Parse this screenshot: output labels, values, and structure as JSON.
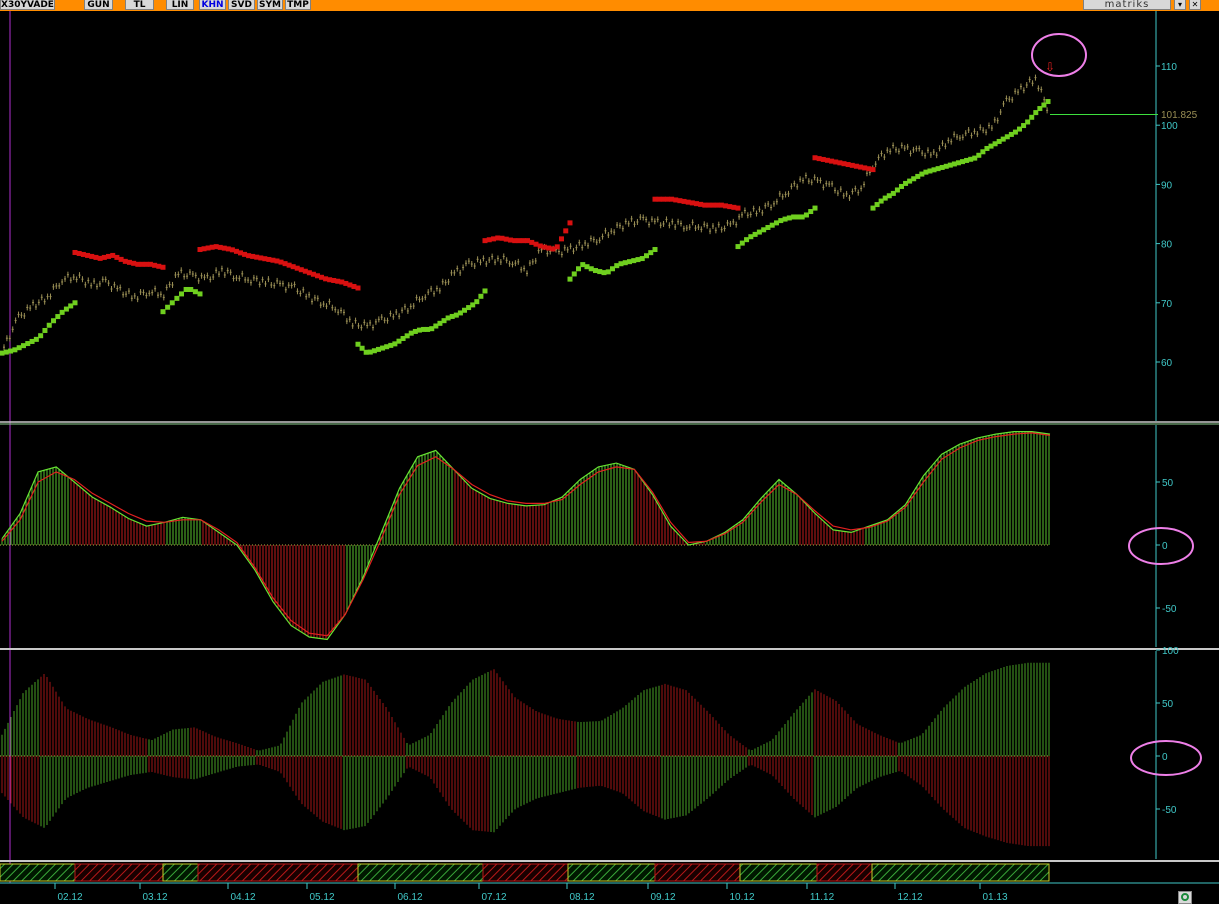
{
  "toolbar": {
    "symbol": "X30YVADE",
    "buttons": [
      {
        "label": "GUN",
        "active": false
      },
      {
        "label": "TL",
        "active": false
      },
      {
        "label": "LIN",
        "active": false
      },
      {
        "label": "KHN",
        "active": true
      },
      {
        "label": "SVD",
        "active": false
      },
      {
        "label": "SYM",
        "active": false
      },
      {
        "label": "TMP",
        "active": false
      }
    ],
    "brand": "matriks",
    "controls": [
      "scroll-down-icon",
      "close-icon"
    ]
  },
  "colors": {
    "toolbar_bg": "#ff8c00",
    "price": "#9a8f55",
    "trail_up": "#6fcf1f",
    "trail_down": "#d81010",
    "osc_up": "#66e233",
    "osc_down": "#e22020",
    "axis": "#40c8c8",
    "highlight_circle": "#ee7fe8"
  },
  "chart_data": [
    {
      "type": "line",
      "title": "",
      "last_price_label": "101.825",
      "ylim": [
        50,
        115
      ],
      "yticks": [
        50,
        60,
        70,
        80,
        90,
        100,
        110
      ],
      "xticks": [
        "02.12",
        "03.12",
        "04.12",
        "05.12",
        "06.12",
        "07.12",
        "08.12",
        "09.12",
        "10.12",
        "11.12",
        "12.12",
        "01.13"
      ],
      "series": [
        {
          "values": [
            62.5,
            67.5,
            69.5,
            71.0,
            74.0,
            74.5,
            73.0,
            73.5,
            72.0,
            71.0,
            72.0,
            71.5,
            75.0,
            74.5,
            74.0,
            75.5,
            74.5,
            74.0,
            73.5,
            73.0,
            72.5,
            71.0,
            70.0,
            69.0,
            66.5,
            66.0,
            67.0,
            68.0,
            69.5,
            71.5,
            72.5,
            75.0,
            76.5,
            77.0,
            77.5,
            77.0,
            75.5,
            79.0,
            78.5,
            79.0,
            80.0,
            81.0,
            82.5,
            83.5,
            84.0,
            83.5,
            83.5,
            83.0,
            83.0,
            82.5,
            83.0,
            85.0,
            85.5,
            87.0,
            89.0,
            91.0,
            90.5,
            89.5,
            88.0,
            89.5,
            94.0,
            96.0,
            96.0,
            95.5,
            95.0,
            97.5,
            98.5,
            99.0,
            99.5,
            104.0,
            106.0,
            108.0,
            101.8
          ]
        }
      ],
      "trail_up_segments": [
        [
          61.5,
          62.0,
          63.0,
          64.0,
          66.5,
          68.5,
          70.0
        ],
        [
          68.5,
          70.5,
          72.5,
          71.5
        ],
        [
          63.0,
          61.5,
          62.0,
          62.5,
          63.0,
          64.0,
          65.0,
          65.5,
          65.5,
          66.5,
          67.5,
          68.0,
          69.0,
          70.0,
          72.0
        ],
        [
          74.0,
          76.5,
          75.5,
          75.0,
          76.5,
          77.0,
          77.5,
          79.0
        ],
        [
          79.5,
          81.0,
          82.0,
          83.0,
          84.0,
          84.5,
          84.5,
          86.0
        ],
        [
          86.0,
          87.5,
          88.5,
          90.0,
          91.0,
          92.0,
          92.5,
          93.0,
          93.5,
          94.0,
          94.5,
          96.0,
          97.0,
          98.0,
          99.0,
          100.5,
          102.5,
          104.0
        ]
      ],
      "trail_down_segments": [
        [
          78.5,
          78.0,
          77.5,
          78.0,
          77.0,
          76.5,
          76.5,
          76.0
        ],
        [
          79.0,
          79.5,
          79.0,
          78.0,
          77.5,
          77.0,
          76.0,
          75.0,
          74.0,
          73.5,
          72.5
        ],
        [
          80.5,
          81.0,
          80.5,
          80.5,
          79.5,
          79.0,
          83.5
        ],
        [
          87.5,
          87.5,
          87.0,
          86.5,
          86.5,
          86.0
        ],
        [
          94.5,
          94.0,
          93.5,
          93.0,
          92.5
        ]
      ],
      "annotations": [
        "sell-arrow-icon",
        "highlight-circle"
      ]
    },
    {
      "type": "line",
      "title": "",
      "ylim": [
        -80,
        95
      ],
      "yticks": [
        -50,
        0,
        50
      ],
      "series": [
        {
          "values": [
            5,
            25,
            58,
            62,
            50,
            38,
            30,
            21,
            15,
            18,
            22,
            20,
            10,
            0,
            -20,
            -45,
            -64,
            -73,
            -75,
            -55,
            -25,
            10,
            45,
            70,
            75,
            60,
            45,
            37,
            33,
            31,
            32,
            38,
            52,
            62,
            65,
            60,
            40,
            15,
            0,
            3,
            10,
            20,
            37,
            52,
            40,
            25,
            12,
            10,
            15,
            20,
            32,
            55,
            72,
            80,
            85,
            88,
            90,
            90,
            88
          ]
        },
        {
          "values": [
            3,
            20,
            50,
            58,
            52,
            41,
            33,
            25,
            19,
            18,
            20,
            20,
            12,
            2,
            -18,
            -42,
            -60,
            -70,
            -72,
            -55,
            -27,
            5,
            40,
            63,
            70,
            60,
            48,
            40,
            35,
            33,
            33,
            36,
            48,
            58,
            62,
            60,
            42,
            18,
            2,
            3,
            9,
            18,
            34,
            48,
            40,
            27,
            15,
            12,
            14,
            19,
            30,
            50,
            68,
            77,
            83,
            86,
            88,
            89,
            87
          ]
        }
      ],
      "annotations": [
        "highlight-circle"
      ]
    },
    {
      "type": "bar",
      "title": "",
      "ylim": [
        -90,
        100
      ],
      "yticks": [
        -50,
        0,
        50,
        100
      ],
      "upper_values": [
        20,
        60,
        78,
        45,
        35,
        28,
        20,
        15,
        25,
        27,
        18,
        12,
        5,
        10,
        50,
        70,
        77,
        72,
        45,
        10,
        20,
        50,
        72,
        82,
        55,
        42,
        35,
        32,
        33,
        45,
        62,
        68,
        62,
        42,
        20,
        5,
        15,
        40,
        63,
        52,
        30,
        20,
        12,
        20,
        45,
        65,
        78,
        85,
        88,
        88
      ],
      "lower_values": [
        -35,
        -58,
        -68,
        -40,
        -30,
        -24,
        -18,
        -15,
        -20,
        -22,
        -16,
        -10,
        -8,
        -15,
        -45,
        -62,
        -70,
        -66,
        -40,
        -10,
        -20,
        -50,
        -70,
        -72,
        -50,
        -40,
        -35,
        -30,
        -28,
        -35,
        -52,
        -60,
        -56,
        -40,
        -22,
        -8,
        -18,
        -40,
        -58,
        -48,
        -30,
        -20,
        -14,
        -28,
        -50,
        -68,
        -76,
        -82,
        -85,
        -85
      ]
    }
  ],
  "signal_bar": {
    "segments": [
      {
        "state": "up",
        "span": 75
      },
      {
        "state": "down",
        "span": 88
      },
      {
        "state": "up",
        "span": 35
      },
      {
        "state": "down",
        "span": 160
      },
      {
        "state": "up",
        "span": 125
      },
      {
        "state": "down",
        "span": 85
      },
      {
        "state": "up",
        "span": 87
      },
      {
        "state": "down",
        "span": 85
      },
      {
        "state": "up",
        "span": 77
      },
      {
        "state": "down",
        "span": 55
      },
      {
        "state": "up",
        "span": 177
      }
    ]
  }
}
